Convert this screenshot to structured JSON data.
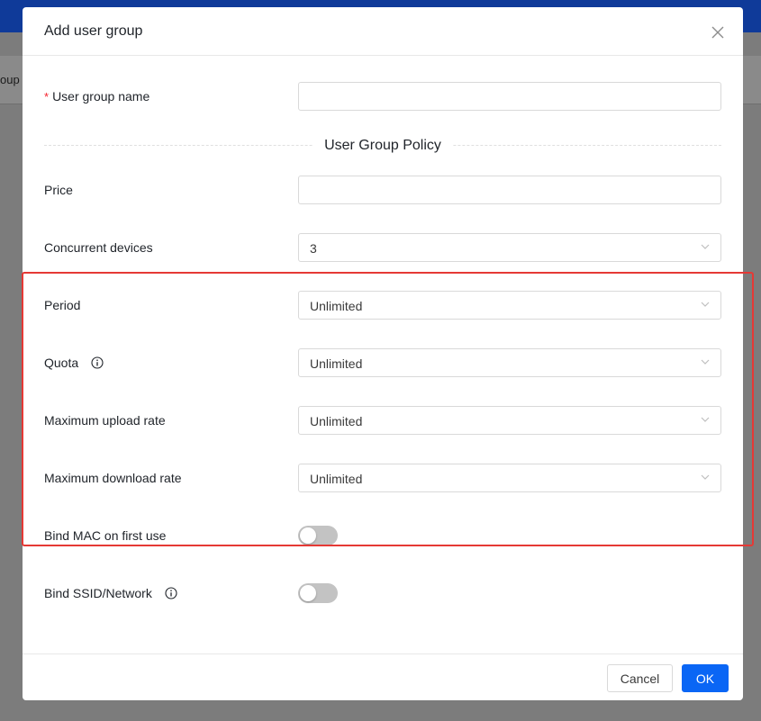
{
  "background": {
    "tab_fragment": "oup"
  },
  "modal": {
    "title": "Add user group",
    "close_icon": "close-icon"
  },
  "form": {
    "user_group_name": {
      "required_mark": "*",
      "label": "User group name",
      "value": "",
      "placeholder": ""
    },
    "section_title": "User Group Policy",
    "price": {
      "label": "Price",
      "value": "",
      "placeholder": ""
    },
    "concurrent_devices": {
      "label": "Concurrent devices",
      "value": "3"
    },
    "period": {
      "label": "Period",
      "value": "Unlimited"
    },
    "quota": {
      "label": "Quota",
      "value": "Unlimited",
      "icon": "info-icon"
    },
    "max_upload_rate": {
      "label": "Maximum upload rate",
      "value": "Unlimited"
    },
    "max_download_rate": {
      "label": "Maximum download rate",
      "value": "Unlimited"
    },
    "bind_mac": {
      "label": "Bind MAC on first use",
      "enabled": false
    },
    "bind_ssid": {
      "label": "Bind SSID/Network",
      "enabled": false,
      "icon": "info-icon"
    }
  },
  "footer": {
    "cancel_label": "Cancel",
    "ok_label": "OK"
  },
  "colors": {
    "primary": "#0a66f5",
    "highlight": "#e53935",
    "required": "#f5222d",
    "toggle_off": "#c3c3c3"
  }
}
